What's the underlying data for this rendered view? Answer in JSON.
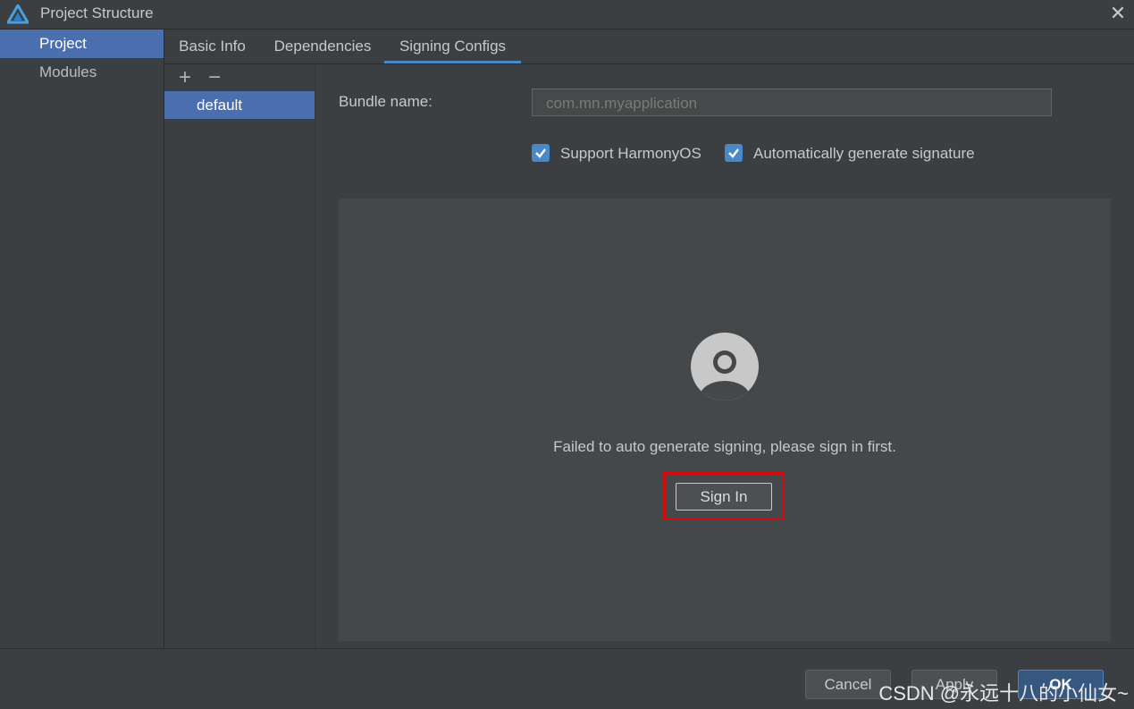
{
  "window": {
    "title": "Project Structure",
    "app_icon": "harmony-logo-icon",
    "close_icon": "close-icon",
    "close_glyph": "✕"
  },
  "sidebar": {
    "items": [
      {
        "label": "Project",
        "active": true
      },
      {
        "label": "Modules",
        "active": false
      }
    ]
  },
  "tabs": [
    {
      "label": "Basic Info",
      "active": false
    },
    {
      "label": "Dependencies",
      "active": false
    },
    {
      "label": "Signing Configs",
      "active": true
    }
  ],
  "configs": {
    "add_glyph": "+",
    "remove_glyph": "−",
    "items": [
      "default"
    ]
  },
  "signing": {
    "bundle_label": "Bundle name:",
    "bundle_value": "com.mn.myapplication",
    "support_harmony": {
      "label": "Support HarmonyOS",
      "checked": true
    },
    "auto_sign": {
      "label": "Automatically generate signature",
      "checked": true
    },
    "message": "Failed to auto generate signing, please sign in first.",
    "sign_in_label": "Sign In"
  },
  "footer": {
    "cancel_label": "Cancel",
    "apply_label": "Apply",
    "ok_label": "OK"
  },
  "watermark": "CSDN @永远十八的小仙女~",
  "colors": {
    "accent": "#4a88c7",
    "selection": "#4b6eaf",
    "highlight_border": "#d40c0c",
    "background": "#3c3f41"
  }
}
